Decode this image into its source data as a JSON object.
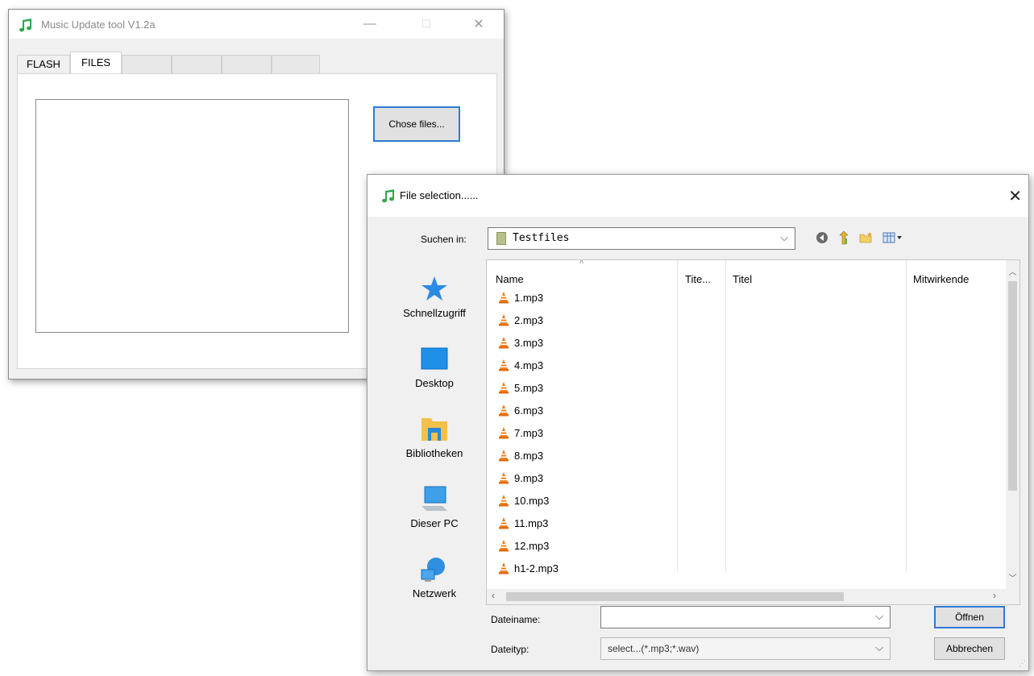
{
  "main_window": {
    "title": "Music Update tool V1.2a",
    "controls": {
      "minimize": "—",
      "maximize": "☐",
      "close": "✕"
    },
    "tabs": [
      {
        "label": "FLASH",
        "active": false
      },
      {
        "label": "FILES",
        "active": true
      },
      {
        "label": "",
        "active": false
      },
      {
        "label": "",
        "active": false
      },
      {
        "label": "",
        "active": false
      },
      {
        "label": "",
        "active": false
      }
    ],
    "chose_files_button": "Chose files..."
  },
  "dialog": {
    "title": "File selection......",
    "close": "✕",
    "look_in_label": "Suchen in:",
    "look_in_value": "Testfiles",
    "toolbar_icons": [
      "back-icon",
      "up-folder-icon",
      "new-folder-icon",
      "view-menu-icon"
    ],
    "places": [
      {
        "label": "Schnellzugriff",
        "icon": "star-icon"
      },
      {
        "label": "Desktop",
        "icon": "desktop-icon"
      },
      {
        "label": "Bibliotheken",
        "icon": "libraries-icon"
      },
      {
        "label": "Dieser PC",
        "icon": "computer-icon"
      },
      {
        "label": "Netzwerk",
        "icon": "network-icon"
      }
    ],
    "columns": [
      "Name",
      "Tite...",
      "Titel",
      "Mitwirkende"
    ],
    "files": [
      "1.mp3",
      "2.mp3",
      "3.mp3",
      "4.mp3",
      "5.mp3",
      "6.mp3",
      "7.mp3",
      "8.mp3",
      "9.mp3",
      "10.mp3",
      "11.mp3",
      "12.mp3",
      "h1-2.mp3"
    ],
    "filename_label": "Dateiname:",
    "filename_value": "",
    "filetype_label": "Dateityp:",
    "filetype_value": "select...(*.mp3;*.wav)",
    "open_button": "Öffnen",
    "cancel_button": "Abbrechen"
  },
  "colors": {
    "accent": "#2e7bd6",
    "app_icon": "#2fa84f",
    "file_icon": "#f07d1a"
  }
}
